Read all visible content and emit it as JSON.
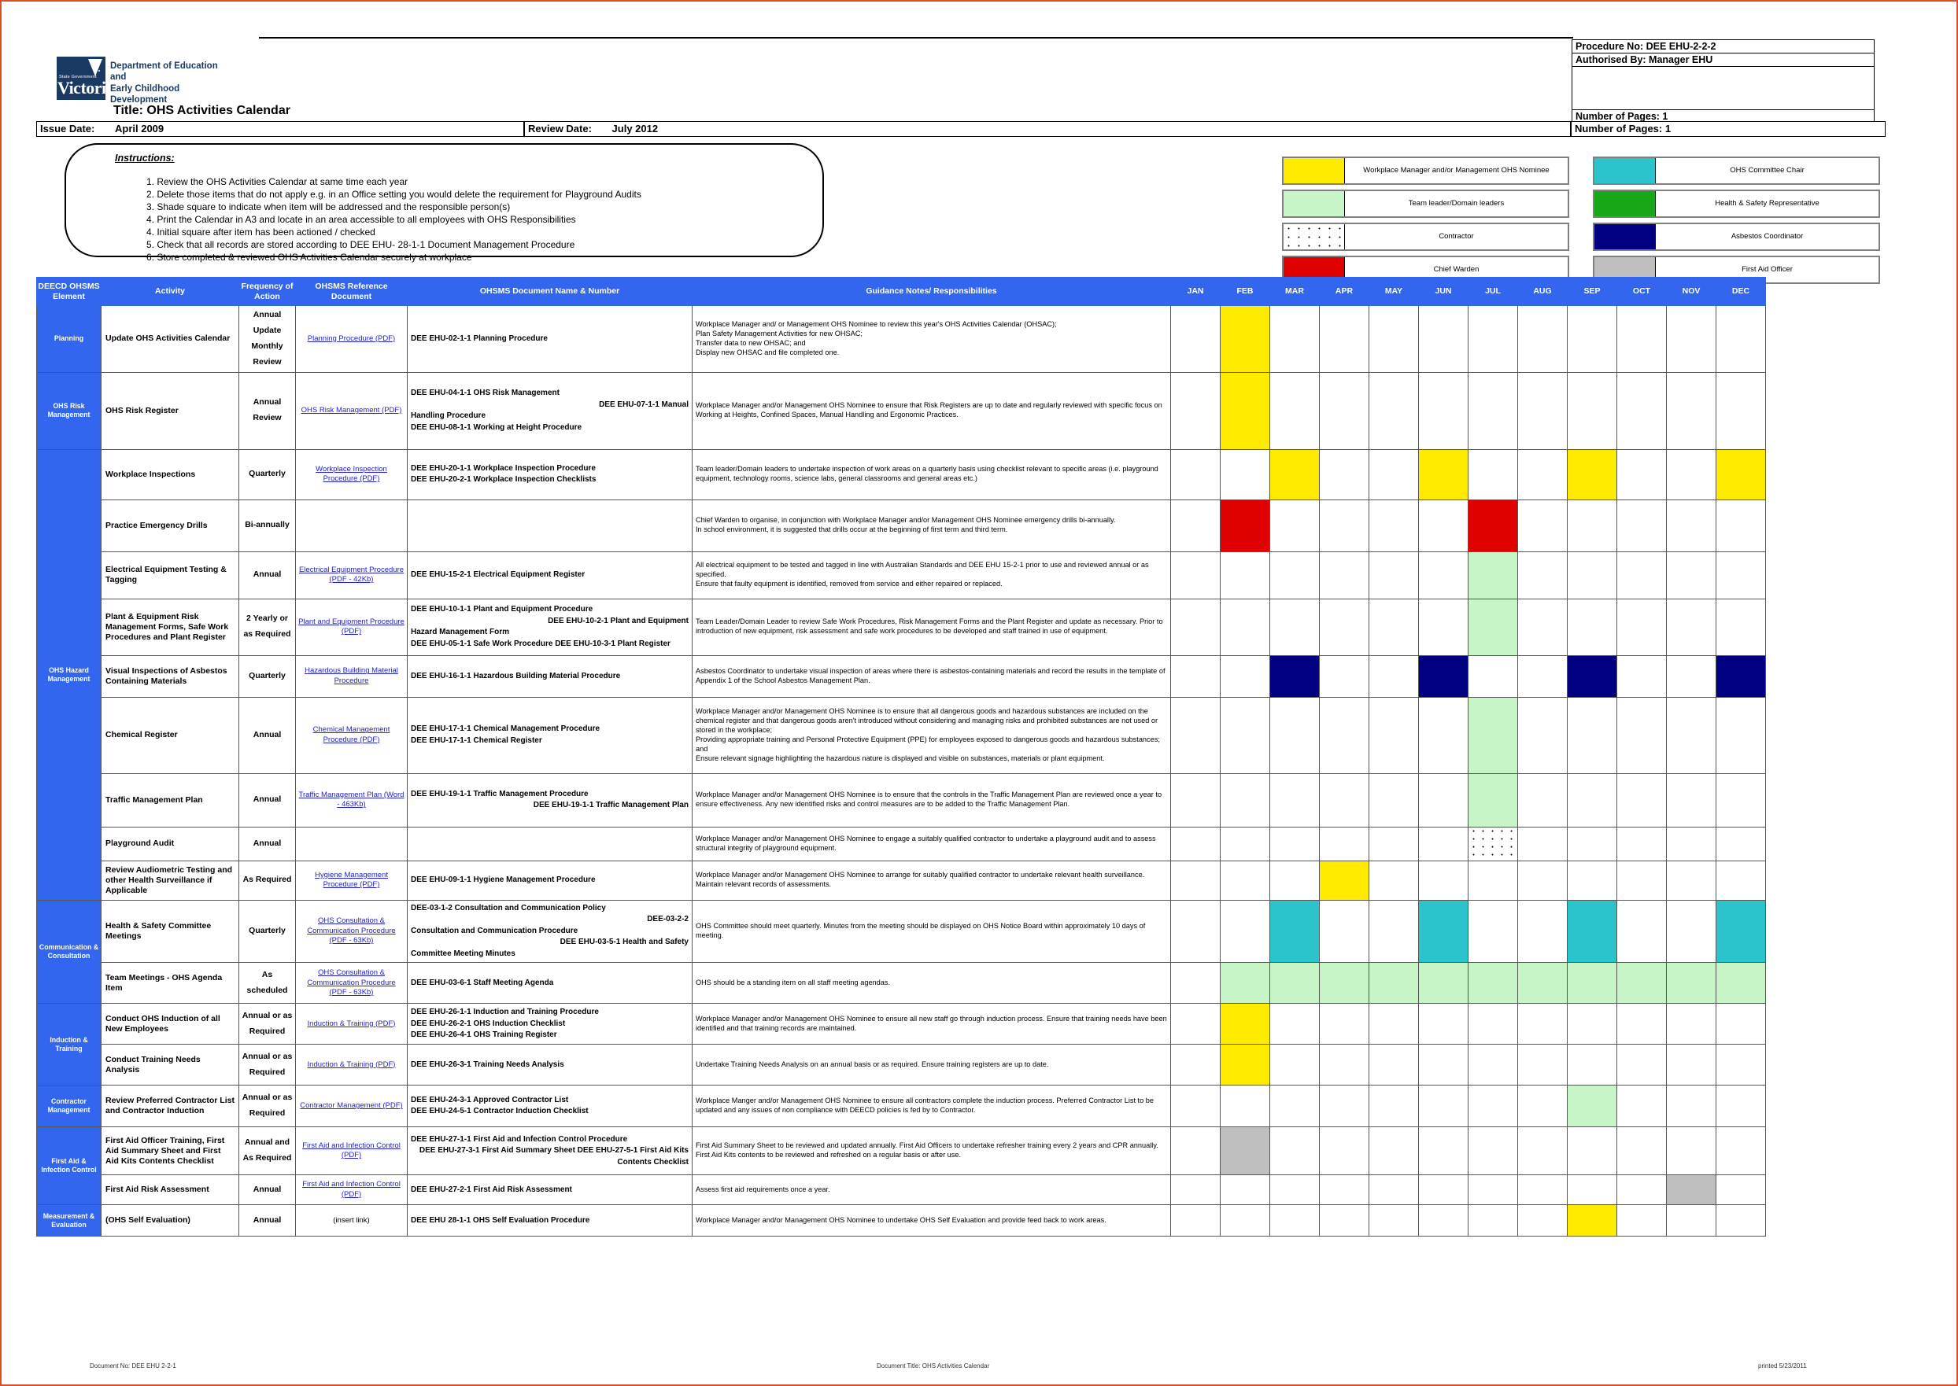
{
  "header": {
    "org_state": "State Government",
    "org_name": "Victoria",
    "dept_line1": "Department of Education and",
    "dept_line2": "Early Childhood Development",
    "title": "Title: OHS Activities Calendar",
    "procedure_no": "Procedure No: DEE EHU-2-2-2",
    "authorised_by": "Authorised By: Manager EHU",
    "number_of_pages": "Number of Pages: 1",
    "issue_date_label": "Issue Date:",
    "issue_date_value": "April 2009",
    "review_date_label": "Review Date:",
    "review_date_value": "July 2012"
  },
  "instructions": {
    "title": "Instructions:",
    "items": [
      "1. Review the OHS Activities Calendar at same time each year",
      "2. Delete those items that do not apply e.g. in an Office setting you would delete the requirement for Playground Audits",
      "3. Shade square to indicate when item will be addressed and the responsible person(s)",
      "4. Print the Calendar in A3 and locate in an area accessible to all employees with OHS Responsibilities",
      "4. Initial square after item has been actioned / checked",
      "5. Check that all records are stored according to DEE EHU- 28-1-1 Document Management Procedure",
      "6. Store completed & reviewed OHS Activities Calendar securely at workplace"
    ]
  },
  "legend": [
    {
      "label": "Workplace Manager and/or Management OHS Nominee",
      "color": "#ffeb00",
      "swatch": "yellow"
    },
    {
      "label": "OHS Committee Chair",
      "color": "#2cc4cc",
      "swatch": "teal"
    },
    {
      "label": "Team leader/Domain leaders",
      "color": "#c8f5c8",
      "swatch": "green"
    },
    {
      "label": "Health & Safety Representative",
      "color": "#16a816",
      "swatch": "brightgreen"
    },
    {
      "label": "Contractor",
      "color": "#ffffff",
      "swatch": "dots"
    },
    {
      "label": "Asbestos Coordinator",
      "color": "#000080",
      "swatch": "navy"
    },
    {
      "label": "Chief Warden",
      "color": "#e00000",
      "swatch": "red"
    },
    {
      "label": "First Aid Officer",
      "color": "#bfbfbf",
      "swatch": "grey"
    }
  ],
  "table": {
    "columns": [
      "DEECD OHSMS Element",
      "Activity",
      "Frequency of Action",
      "OHSMS Reference Document",
      "OHSMS Document Name & Number",
      "Guidance Notes/ Responsibilities"
    ],
    "months": [
      "JAN",
      "FEB",
      "MAR",
      "APR",
      "MAY",
      "JUN",
      "JUL",
      "AUG",
      "SEP",
      "OCT",
      "NOV",
      "DEC"
    ],
    "rows": [
      {
        "element": "Planning",
        "element_rowspan": 1,
        "activity": "Update OHS Activities Calendar",
        "frequency": "Annual Update\nMonthly Review",
        "reference": "Planning Procedure (PDF)",
        "reference_link": true,
        "document": "DEE EHU-02-1-1 Planning Procedure",
        "guidance": "Workplace Manager and/ or Management OHS Nominee to review this year's OHS Activities Calendar (OHSAC);\nPlan Safety Management Activities for new OHSAC;\nTransfer data to new OHSAC; and\nDisplay new OHSAC and file completed one.",
        "months": [
          "",
          "yellow",
          "",
          "",
          "",
          "",
          "",
          "",
          "",
          "",
          "",
          ""
        ],
        "height": 68
      },
      {
        "element": "OHS Risk Management",
        "element_rowspan": 1,
        "activity": "OHS Risk Register",
        "frequency": "Annual Review",
        "reference": "OHS Risk Management (PDF)",
        "reference_link": true,
        "document": "DEE EHU-04-1-1 OHS Risk Management\n                 DEE EHU-07-1-1 Manual\nHandling Procedure\n\n     DEE EHU-08-1-1 Working at Height Procedure",
        "guidance": "Workplace Manager and/or Management OHS Nominee to ensure that Risk Registers are up to date and regularly reviewed with specific focus on  Working at Heights, Confined Spaces, Manual Handling and Ergonomic Practices.",
        "months": [
          "",
          "yellow",
          "",
          "",
          "",
          "",
          "",
          "",
          "",
          "",
          "",
          ""
        ],
        "height": 98
      },
      {
        "element": "OHS Hazard Management",
        "element_rowspan": 9,
        "activity": "Workplace Inspections",
        "frequency": "Quarterly",
        "reference": "Workplace Inspection Procedure (PDF)",
        "reference_link": true,
        "document": "DEE EHU-20-1-1 Workplace Inspection Procedure\nDEE EHU-20-2-1 Workplace Inspection Checklists",
        "guidance": "Team leader/Domain leaders to undertake inspection of work areas on a quarterly basis using checklist relevant to specific areas (i.e. playground equipment, technology rooms, science labs, general classrooms and general areas etc.)",
        "months": [
          "",
          "",
          "yellow",
          "",
          "",
          "yellow",
          "",
          "",
          "yellow",
          "",
          "",
          "yellow"
        ],
        "height": 64
      },
      {
        "element": "",
        "activity": "Practice Emergency Drills",
        "frequency": "Bi-annually",
        "reference": "",
        "document": "",
        "guidance": "Chief Warden to organise, in conjunction with Workplace Manager and/or Management OHS Nominee emergency drills bi-annually.\nIn school environment, it is suggested that drills occur at the beginning of first term and third term.",
        "months": [
          "",
          "red",
          "",
          "",
          "",
          "",
          "red",
          "",
          "",
          "",
          "",
          ""
        ],
        "height": 66
      },
      {
        "element": "",
        "activity": "Electrical Equipment Testing & Tagging",
        "frequency": "Annual",
        "reference": "Electrical  Equipment  Procedure (PDF - 42Kb)",
        "reference_link": true,
        "document": "DEE EHU-15-2-1 Electrical Equipment Register",
        "guidance": "All electrical equipment to be tested and tagged in line with Australian Standards and DEE EHU 15-2-1 prior to use and reviewed annual or as specified.\nEnsure that faulty equipment is identified, removed from service and either repaired or replaced.",
        "months": [
          "",
          "",
          "",
          "",
          "",
          "",
          "green",
          "",
          "",
          "",
          "",
          ""
        ],
        "height": 60
      },
      {
        "element": "",
        "activity": "Plant & Equipment Risk Management Forms, Safe Work Procedures and Plant Register",
        "frequency": "2 Yearly or as Required",
        "reference": "Plant and Equipment Procedure (PDF)",
        "reference_link": true,
        "document": "DEE EHU-10-1-1 Plant and Equipment Procedure\n              DEE EHU-10-2-1 Plant and Equipment\nHazard Management Form\nDEE EHU-05-1-1 Safe Work Procedure              DEE EHU-10-3-1 Plant Register",
        "guidance": "Team Leader/Domain Leader to review Safe Work Procedures, Risk Management Forms and the Plant Register and update as necessary.  Prior to introduction of new equipment, risk assessment and safe work procedures to be developed and staff trained in use of equipment.",
        "months": [
          "",
          "",
          "",
          "",
          "",
          "",
          "green",
          "",
          "",
          "",
          "",
          ""
        ],
        "height": 72
      },
      {
        "element": "",
        "activity": "Visual Inspections of Asbestos Containing Materials",
        "frequency": "Quarterly",
        "reference": "Hazardous Building Material Procedure",
        "reference_link": true,
        "document": "DEE EHU-16-1-1 Hazardous Building Material Procedure",
        "guidance": "Asbestos Coordinator to undertake visual inspection of areas where there is asbestos-containing materials and record the results in the template of Appendix 1 of the School Asbestos Management Plan.",
        "months": [
          "",
          "",
          "navy",
          "",
          "",
          "navy",
          "",
          "",
          "navy",
          "",
          "",
          "navy"
        ],
        "height": 53
      },
      {
        "element": "",
        "activity": "Chemical Register",
        "frequency": "Annual",
        "reference": "Chemical Management Procedure (PDF)",
        "reference_link": true,
        "document": "DEE EHU-17-1-1 Chemical Management Procedure\nDEE EHU-17-1-1 Chemical Register",
        "guidance": "Workplace Manager and/or Management OHS Nominee is to  ensure that all dangerous goods and hazardous substances are included on the chemical register and that dangerous goods aren't introduced without considering and managing risks and prohibited substances are not used or stored in the workplace;\nProviding appropriate training and Personal Protective Equipment (PPE) for employees exposed to dangerous goods and hazardous substances; and\nEnsure relevant signage highlighting the hazardous nature is displayed and visible on substances, materials or plant equipment.",
        "months": [
          "",
          "",
          "",
          "",
          "",
          "",
          "green",
          "",
          "",
          "",
          "",
          ""
        ],
        "height": 97
      },
      {
        "element": "",
        "activity": "Traffic Management Plan",
        "frequency": "Annual",
        "reference": "Traffic Management Plan (Word - 463Kb)",
        "reference_link": true,
        "document": "DEE EHU-19-1-1 Traffic Management Procedure\n              DEE EHU-19-1-1 Traffic Management Plan",
        "guidance": "Workplace Manager and/or Management OHS Nominee is to ensure that the controls in the Traffic Management Plan are reviewed once a year to ensure effectiveness. Any new identified risks and control measures are to be added to the Traffic Management Plan.",
        "months": [
          "",
          "",
          "",
          "",
          "",
          "",
          "green",
          "",
          "",
          "",
          "",
          ""
        ],
        "height": 68
      },
      {
        "element": "",
        "activity": "Playground Audit",
        "frequency": "Annual",
        "reference": "",
        "document": "",
        "guidance": "Workplace Manager and/or Management OHS Nominee to engage a suitably qualified contractor to undertake a playground audit and to assess structural integrity of playground equipment.",
        "months": [
          "",
          "",
          "",
          "",
          "",
          "",
          "dots",
          "",
          "",
          "",
          "",
          ""
        ],
        "height": 43
      },
      {
        "element": "",
        "activity": "Review Audiometric Testing and other Health Surveillance if Applicable",
        "frequency": "As Required",
        "reference": "Hygiene Management Procedure (PDF)",
        "reference_link": true,
        "document": "DEE EHU-09-1-1 Hygiene Management Procedure",
        "guidance": "Workplace Manager and/or Management OHS Nominee to arrange for suitably qualified contractor to undertake relevant health surveillance. Maintain relevant records of assessments.",
        "months": [
          "",
          "",
          "",
          "yellow",
          "",
          "",
          "",
          "",
          "",
          "",
          "",
          ""
        ],
        "height": 50
      },
      {
        "element": "Communication & Consultation",
        "element_rowspan": 2,
        "activity": "Health & Safety Committee Meetings",
        "frequency": "Quarterly",
        "reference": "OHS Consultation & Communication Procedure (PDF - 63Kb)",
        "reference_link": true,
        "document": "DEE-03-1-2 Consultation and Communication Policy\n                 DEE-03-2-2\nConsultation and Communication Procedure\n              DEE EHU-03-5-1 Health and Safety\nCommittee Meeting Minutes",
        "guidance": "OHS Committee should meet quarterly.  Minutes from the meeting should be displayed on OHS Notice Board within approximately 10 days of meeting.",
        "months": [
          "",
          "",
          "teal",
          "",
          "",
          "teal",
          "",
          "",
          "teal",
          "",
          "",
          "teal"
        ],
        "height": 79
      },
      {
        "element": "",
        "activity": "Team Meetings - OHS Agenda Item",
        "frequency": "As scheduled",
        "reference": "OHS Consultation & Communication Procedure (PDF - 63Kb)",
        "reference_link": true,
        "document": "DEE EHU-03-6-1 Staff Meeting Agenda",
        "guidance": "OHS should be a standing item on all staff meeting agendas.",
        "months": [
          "",
          "green",
          "green",
          "green",
          "green",
          "green",
          "green",
          "green",
          "green",
          "green",
          "green",
          "green"
        ],
        "height": 52
      },
      {
        "element": "Induction & Training",
        "element_rowspan": 2,
        "activity": "Conduct OHS Induction of all New Employees",
        "frequency": "Annual or as Required",
        "reference": "Induction & Training (PDF)",
        "reference_link": true,
        "document": "DEE EHU-26-1-1 Induction and Training Procedure\nDEE EHU-26-2-1 OHS Induction Checklist\nDEE EHU-26-4-1 OHS Training Register",
        "guidance": "Workplace Manager and/or Management OHS Nominee to ensure all new staff go through induction process. Ensure that training needs have been identified and that training records are maintained.",
        "months": [
          "",
          "yellow",
          "",
          "",
          "",
          "",
          "",
          "",
          "",
          "",
          "",
          ""
        ],
        "height": 52
      },
      {
        "element": "",
        "activity": "Conduct Training Needs Analysis",
        "frequency": "Annual or as Required",
        "reference": "Induction & Training (PDF)",
        "reference_link": true,
        "document": "DEE EHU-26-3-1 Training Needs Analysis",
        "guidance": "Undertake Training Needs Analysis on an annual basis or as required. Ensure training registers are up to date.",
        "months": [
          "",
          "yellow",
          "",
          "",
          "",
          "",
          "",
          "",
          "",
          "",
          "",
          ""
        ],
        "height": 52
      },
      {
        "element": "Contractor Management",
        "element_rowspan": 1,
        "activity": "Review Preferred Contractor List and Contractor Induction",
        "frequency": "Annual or as Required",
        "reference": "Contractor Management (PDF)",
        "reference_link": true,
        "document": "DEE EHU-24-3-1 Approved Contractor List\nDEE EHU-24-5-1 Contractor Induction Checklist",
        "guidance": "Workplace Manger and/or Management OHS Nominee to ensure all contractors complete the induction process. Preferred Contractor List to be updated and any issues of non compliance with DEECD policies is fed by to Contractor.",
        "months": [
          "",
          "",
          "",
          "",
          "",
          "",
          "",
          "",
          "green",
          "",
          "",
          ""
        ],
        "height": 53
      },
      {
        "element": "First Aid & Infection Control",
        "element_rowspan": 2,
        "activity": "First Aid Officer Training, First Aid Summary Sheet and First Aid Kits Contents Checklist",
        "frequency": "Annual and  As Required",
        "reference": "First Aid and Infection Control (PDF)",
        "reference_link": true,
        "document": "DEE EHU-27-1-1  First Aid and Infection Control Procedure\n                 DEE EHU-27-3-1 First Aid Summary Sheet         DEE EHU-27-5-1 First Aid Kits Contents Checklist",
        "guidance": "First Aid Summary Sheet to be reviewed and updated annually. First Aid Officers to undertake refresher training every 2 years and CPR annually. First Aid Kits contents to be reviewed and refreshed on a regular basis or after use.",
        "months": [
          "",
          "grey",
          "",
          "",
          "",
          "",
          "",
          "",
          "",
          "",
          "",
          ""
        ],
        "height": 61
      },
      {
        "element": "",
        "activity": "First Aid Risk Assessment",
        "frequency": "Annual",
        "reference": "First Aid and Infection Control (PDF)",
        "reference_link": true,
        "document": "DEE EHU-27-2-1 First Aid Risk Assessment",
        "guidance": "Assess first aid requirements once a year.",
        "months": [
          "",
          "",
          "",
          "",
          "",
          "",
          "",
          "",
          "",
          "",
          "grey",
          ""
        ],
        "height": 38
      },
      {
        "element": "Measurement & Evaluation",
        "element_rowspan": 1,
        "activity": "(OHS Self Evaluation)",
        "frequency": "Annual",
        "reference": "(insert link)",
        "reference_link": false,
        "document": "DEE EHU 28-1-1 OHS Self Evaluation Procedure",
        "guidance": "Workplace Manager and/or Management OHS Nominee to undertake OHS Self Evaluation and provide feed back to work areas.",
        "months": [
          "",
          "",
          "",
          "",
          "",
          "",
          "",
          "",
          "yellow",
          "",
          "",
          ""
        ],
        "height": 40
      }
    ]
  },
  "footer": {
    "left": "Document No:  DEE EHU 2-2-1",
    "center": "Document Title: OHS Activities Calendar",
    "right": "printed 5/23/2011"
  }
}
